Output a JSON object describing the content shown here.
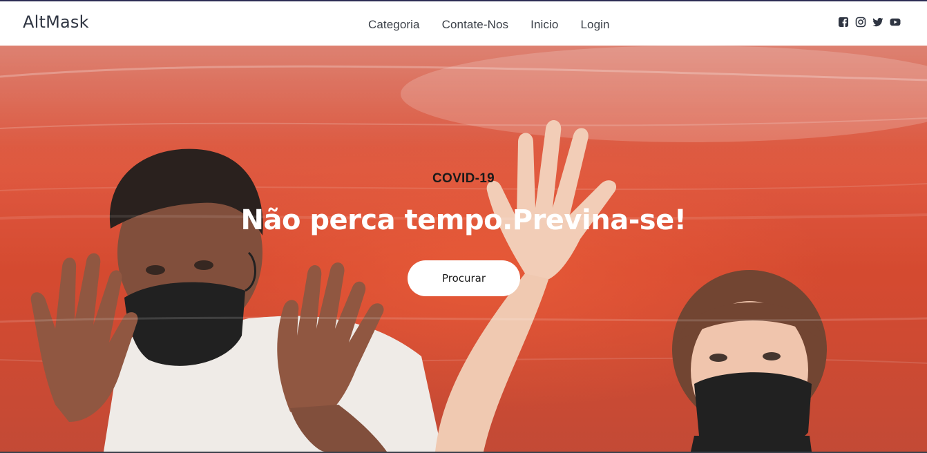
{
  "nav": {
    "brand": "AltMask",
    "links": [
      "Categoria",
      "Contate-Nos",
      "Inicio",
      "Login"
    ],
    "socials": [
      "facebook-icon",
      "instagram-icon",
      "twitter-icon",
      "youtube-icon"
    ]
  },
  "hero": {
    "eyebrow": "COVID-19",
    "headline": "Não perca tempo.Previna-se!",
    "cta_label": "Procurar",
    "colors": {
      "background": "#d93a1c",
      "cta_bg": "#ffffff",
      "headline": "#ffffff"
    }
  }
}
